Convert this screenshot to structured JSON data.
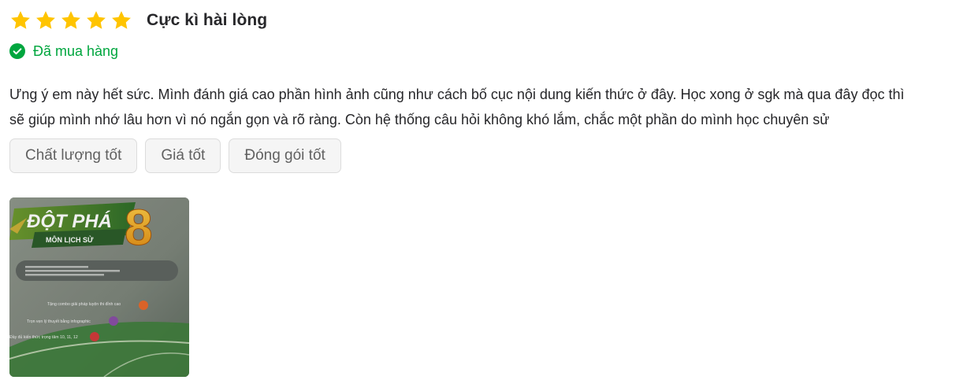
{
  "review": {
    "rating": 5,
    "rating_max": 5,
    "star_color": "#FFC400",
    "rating_label": "Cực kì hài lòng",
    "purchased_label": "Đã mua hàng",
    "purchased_color": "#00A63E",
    "comment_lines": [
      "Ưng ý em này hết sức. Mình đánh giá cao phần hình ảnh cũng như cách bố cục nội dung kiến thức ở đây. Học xong ở sgk mà qua đây đọc thì",
      "sẽ giúp mình nhớ lâu hơn vì nó ngắn gọn và rõ ràng. Còn hệ thống câu hỏi không khó lắm, chắc một phần do mình học chuyên sử"
    ],
    "tags": [
      "Chất lượng tốt",
      "Giá tốt",
      "Đóng gói tốt"
    ],
    "photo": {
      "cover_title": "ĐỘT PHÁ",
      "cover_number": "8",
      "cover_subtitle": "MÔN LỊCH SỬ",
      "cover_features": [
        "Tặng combo giải pháp luyện thi đỉnh cao",
        "Trọn vẹn lý thuyết bằng infographic",
        "Đầy đủ kiến thức trọng tâm 10, 11, 12"
      ]
    }
  }
}
